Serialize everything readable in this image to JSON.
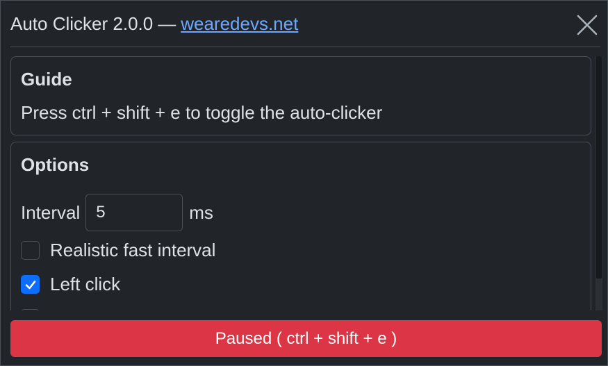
{
  "window": {
    "title": "Auto Clicker 2.0.0",
    "separator": "—",
    "link_text": "wearedevs.net"
  },
  "guide": {
    "heading": "Guide",
    "text": "Press ctrl + shift + e to toggle the auto-clicker"
  },
  "options": {
    "heading": "Options",
    "interval_label": "Interval",
    "interval_value": "5",
    "interval_unit": "ms",
    "realistic_label": "Realistic fast interval",
    "realistic_checked": false,
    "left_click_label": "Left click",
    "left_click_checked": true
  },
  "status": {
    "button_label": "Paused ( ctrl + shift + e )"
  },
  "colors": {
    "background": "#212529",
    "border": "#495057",
    "link": "#6ea8fe",
    "accent": "#0d6efd",
    "danger": "#dc3545"
  },
  "icons": {
    "close": "close-icon",
    "checkmark": "checkmark-icon"
  }
}
